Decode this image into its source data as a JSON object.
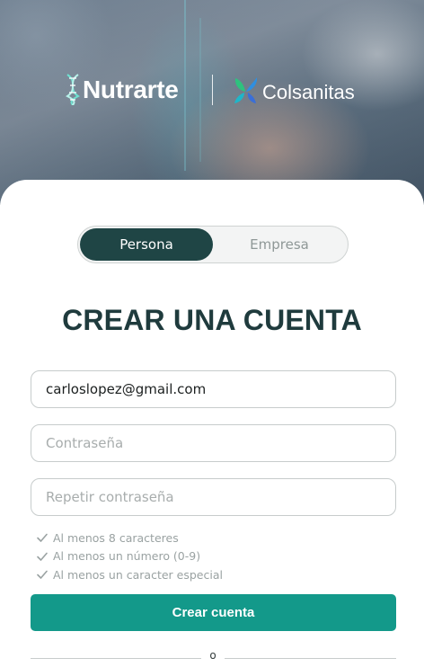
{
  "brands": {
    "primary": "Nutrarte",
    "secondary": "Colsanitas"
  },
  "account_type": {
    "options": [
      "Persona",
      "Empresa"
    ],
    "selected": "Persona"
  },
  "form": {
    "title": "CREAR UNA CUENTA",
    "email_value": "carloslopez@gmail.com",
    "password_placeholder": "Contraseña",
    "repeat_password_placeholder": "Repetir contraseña",
    "requirements": [
      "Al menos 8 caracteres",
      "Al menos un número (0-9)",
      "Al menos un caracter especial"
    ],
    "submit_label": "Crear cuenta",
    "divider_text": "o"
  },
  "colors": {
    "toggle_active": "#1f4545",
    "primary_button": "#13998a",
    "title": "#1f3b3d",
    "requirement_text": "#9aa2a2"
  },
  "icons": {
    "nutrarte_logo": "dna-helix-icon",
    "colsanitas_logo": "colsanitas-leaf-icon",
    "requirement_check": "check-icon"
  }
}
